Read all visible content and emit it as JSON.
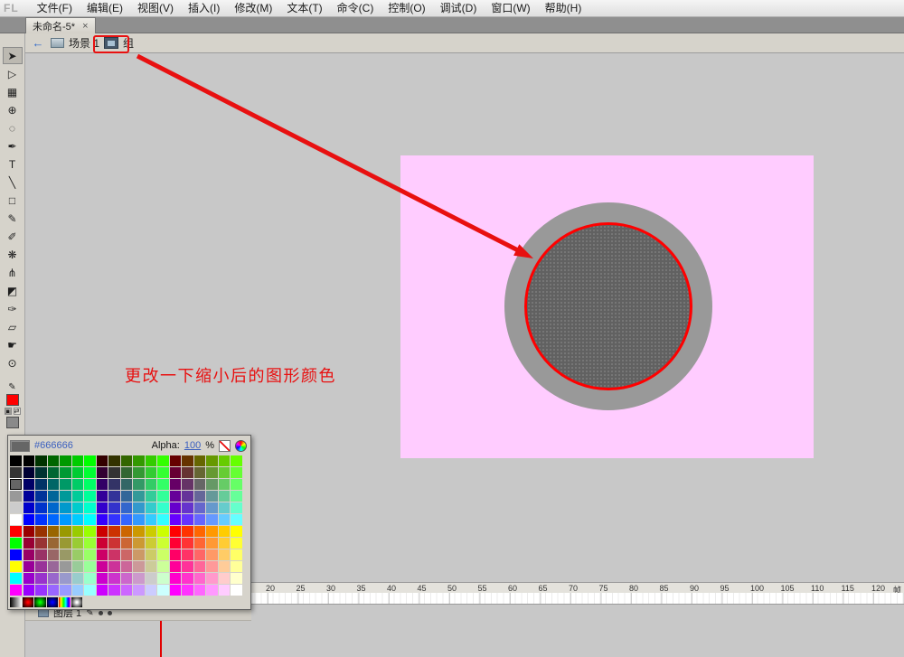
{
  "menu_bar": {
    "logo": "FL",
    "items": [
      "文件(F)",
      "编辑(E)",
      "视图(V)",
      "插入(I)",
      "修改(M)",
      "文本(T)",
      "命令(C)",
      "控制(O)",
      "调试(D)",
      "窗口(W)",
      "帮助(H)"
    ]
  },
  "tab_bar": {
    "tab": {
      "label": "未命名-5*",
      "close_glyph": "×"
    }
  },
  "edit_bar": {
    "back_glyph": "←",
    "scene_label": "场景 1",
    "group_label": "组"
  },
  "toolbar": {
    "tools": [
      {
        "name": "selection-tool",
        "glyph": "➤",
        "active": true
      },
      {
        "name": "subselection-tool",
        "glyph": "▷",
        "active": false
      },
      {
        "name": "free-transform-tool",
        "glyph": "▦",
        "active": false
      },
      {
        "name": "3d-rotation-tool",
        "glyph": "⊕",
        "active": false
      },
      {
        "name": "lasso-tool",
        "glyph": "◌",
        "active": false
      },
      {
        "name": "pen-tool",
        "glyph": "✒",
        "active": false
      },
      {
        "name": "text-tool",
        "glyph": "T",
        "active": false
      },
      {
        "name": "line-tool",
        "glyph": "╲",
        "active": false
      },
      {
        "name": "rectangle-tool",
        "glyph": "□",
        "active": false
      },
      {
        "name": "pencil-tool",
        "glyph": "✎",
        "active": false
      },
      {
        "name": "brush-tool",
        "glyph": "✐",
        "active": false
      },
      {
        "name": "deco-tool",
        "glyph": "❋",
        "active": false
      },
      {
        "name": "bone-tool",
        "glyph": "⋔",
        "active": false
      },
      {
        "name": "paint-bucket-tool",
        "glyph": "◩",
        "active": false
      },
      {
        "name": "eyedropper-tool",
        "glyph": "✑",
        "active": false
      },
      {
        "name": "eraser-tool",
        "glyph": "▱",
        "active": false
      },
      {
        "name": "hand-tool",
        "glyph": "☛",
        "active": false
      },
      {
        "name": "zoom-tool",
        "glyph": "⊙",
        "active": false
      }
    ],
    "icons": {
      "pencil": "✎",
      "default": "▣",
      "swap": "⇄"
    },
    "stroke_color": "#ff0000",
    "fill_color": "#8a8a8a"
  },
  "stage": {
    "fill": "#ffccff"
  },
  "shape": {
    "outer_fill": "#999999",
    "inner_fill": "#616161",
    "ring_color": "#ff0000"
  },
  "annotation": {
    "text": "更改一下缩小后的图形颜色",
    "color": "#e81010"
  },
  "color_picker": {
    "hex_text": "#666666",
    "alpha_label": "Alpha:",
    "alpha_value": "100",
    "percent_sign": "%",
    "left_column": "000000 333333 666666 999999 CCCCCC FFFFFF FF0000 00FF00 0000FF FFFF00 00FFFF FF00FF",
    "selected_left_index": 2,
    "grid_rows": [
      "000000 003300 006600 009900 00CC00 00FF00 330000 333300 336600 339900 33CC00 33FF00 660000 663300 666600 669900 66CC00 66FF00",
      "000033 003333 006633 009933 00CC33 00FF33 330033 333333 336633 339933 33CC33 33FF33 660033 663333 666633 669933 66CC33 66FF33",
      "000066 003366 006666 009966 00CC66 00FF66 330066 333366 336666 339966 33CC66 33FF66 660066 663366 666666 669966 66CC66 66FF66",
      "000099 003399 006699 009999 00CC99 00FF99 330099 333399 336699 339999 33CC99 33FF99 660099 663399 666699 669999 66CC99 66FF99",
      "0000CC 0033CC 0066CC 0099CC 00CCCC 00FFCC 3300CC 3333CC 3366CC 3399CC 33CCCC 33FFCC 6600CC 6633CC 6666CC 6699CC 66CCCC 66FFCC",
      "0000FF 0033FF 0066FF 0099FF 00CCFF 00FFFF 3300FF 3333FF 3366FF 3399FF 33CCFF 33FFFF 6600FF 6633FF 6666FF 6699FF 66CCFF 66FFFF",
      "990000 993300 996600 999900 99CC00 99FF00 CC0000 CC3300 CC6600 CC9900 CCCC00 CCFF00 FF0000 FF3300 FF6600 FF9900 FFCC00 FFFF00",
      "990033 993333 996633 999933 99CC33 99FF33 CC0033 CC3333 CC6633 CC9933 CCCC33 CCFF33 FF0033 FF3333 FF6633 FF9933 FFCC33 FFFF33",
      "990066 993366 996666 999966 99CC66 99FF66 CC0066 CC3366 CC6666 CC9966 CCCC66 CCFF66 FF0066 FF3366 FF6666 FF9966 FFCC66 FFFF66",
      "990099 993399 996699 999999 99CC99 99FF99 CC0099 CC3399 CC6699 CC9999 CCCC99 CCFF99 FF0099 FF3399 FF6699 FF9999 FFCC99 FFFF99",
      "9900CC 9933CC 9966CC 9999CC 99CCCC 99FFCC CC00CC CC33CC CC66CC CC99CC CCCCCC CCFFCC FF00CC FF33CC FF66CC FF99CC FFCCCC FFFFCC",
      "9900FF 9933FF 9966FF 9999FF 99CCFF 99FFFF CC00FF CC33FF CC66FF CC99FF CCCCFF CCFFFF FF00FF FF33FF FF66FF FF99FF FFCCFF FFFFFF"
    ],
    "gradient_row": [
      "linear-bw",
      "radial-red",
      "radial-green",
      "radial-blue",
      "linear-rainbow",
      "radial-bw"
    ]
  },
  "timeline": {
    "ruler_numbers": [
      "20",
      "25",
      "30",
      "35",
      "40",
      "45",
      "50",
      "55",
      "60",
      "65",
      "70",
      "75",
      "80",
      "85",
      "90",
      "95",
      "100",
      "105",
      "110",
      "115",
      "120"
    ],
    "right_label": "帧",
    "layer_name": "图层 1",
    "pencil_glyph": "✎"
  }
}
